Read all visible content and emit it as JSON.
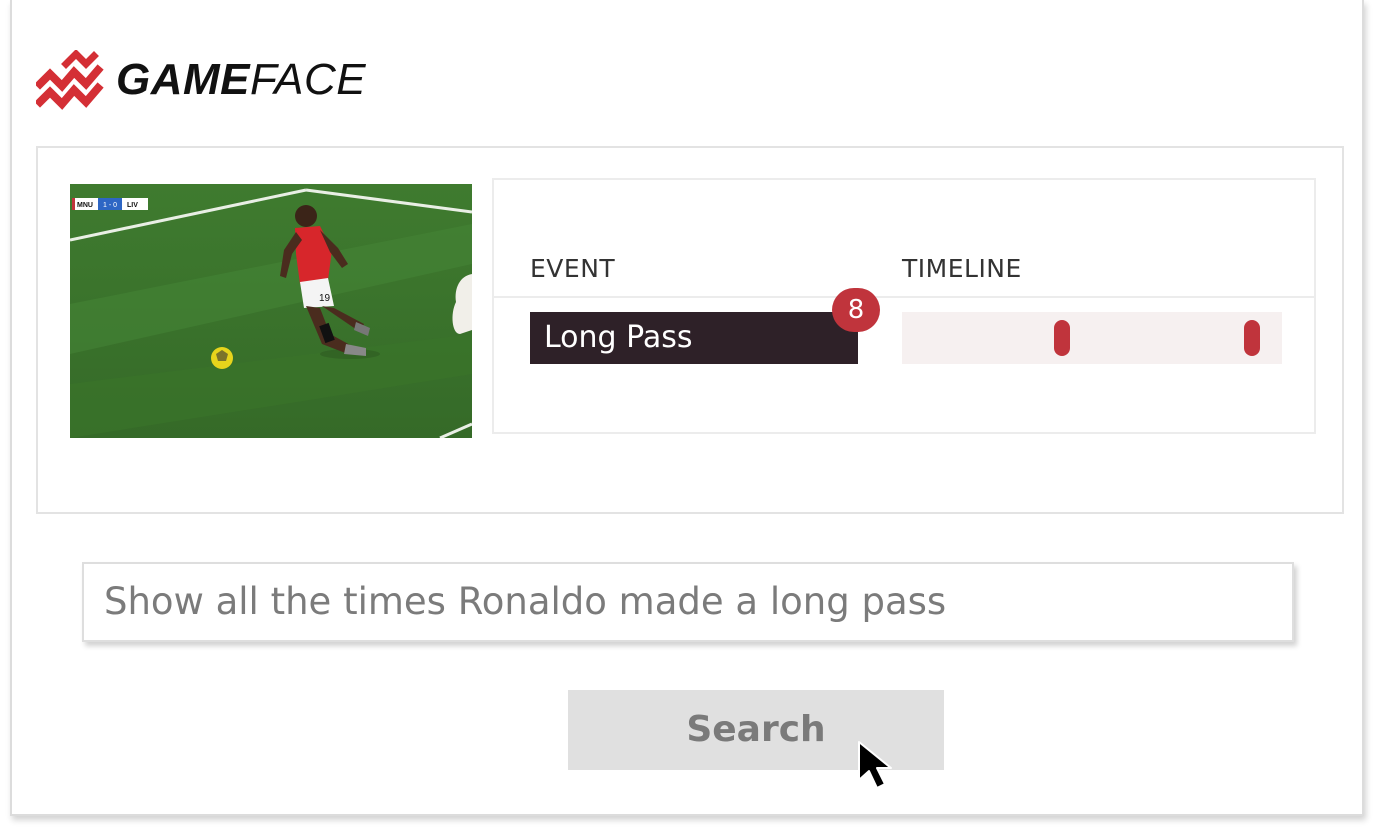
{
  "app": {
    "brand_bold": "GAME",
    "brand_light": "FACE",
    "accent_color": "#c0343c",
    "dark_color": "#2e2128"
  },
  "video": {
    "scoreboard_home": "MNU",
    "scoreboard_score": "1 - 0",
    "scoreboard_away": "LIV",
    "player_number": "19"
  },
  "results": {
    "columns": [
      "EVENT",
      "TIMELINE"
    ],
    "rows": [
      {
        "event": "Long Pass",
        "count": "8",
        "timeline_markers": [
          0.42,
          0.92
        ]
      }
    ]
  },
  "query": {
    "value": "Show all the times Ronaldo made a long pass"
  },
  "search": {
    "label": "Search"
  },
  "icons": {
    "logo": "gameface-logo-icon",
    "cursor": "mouse-pointer-icon"
  }
}
